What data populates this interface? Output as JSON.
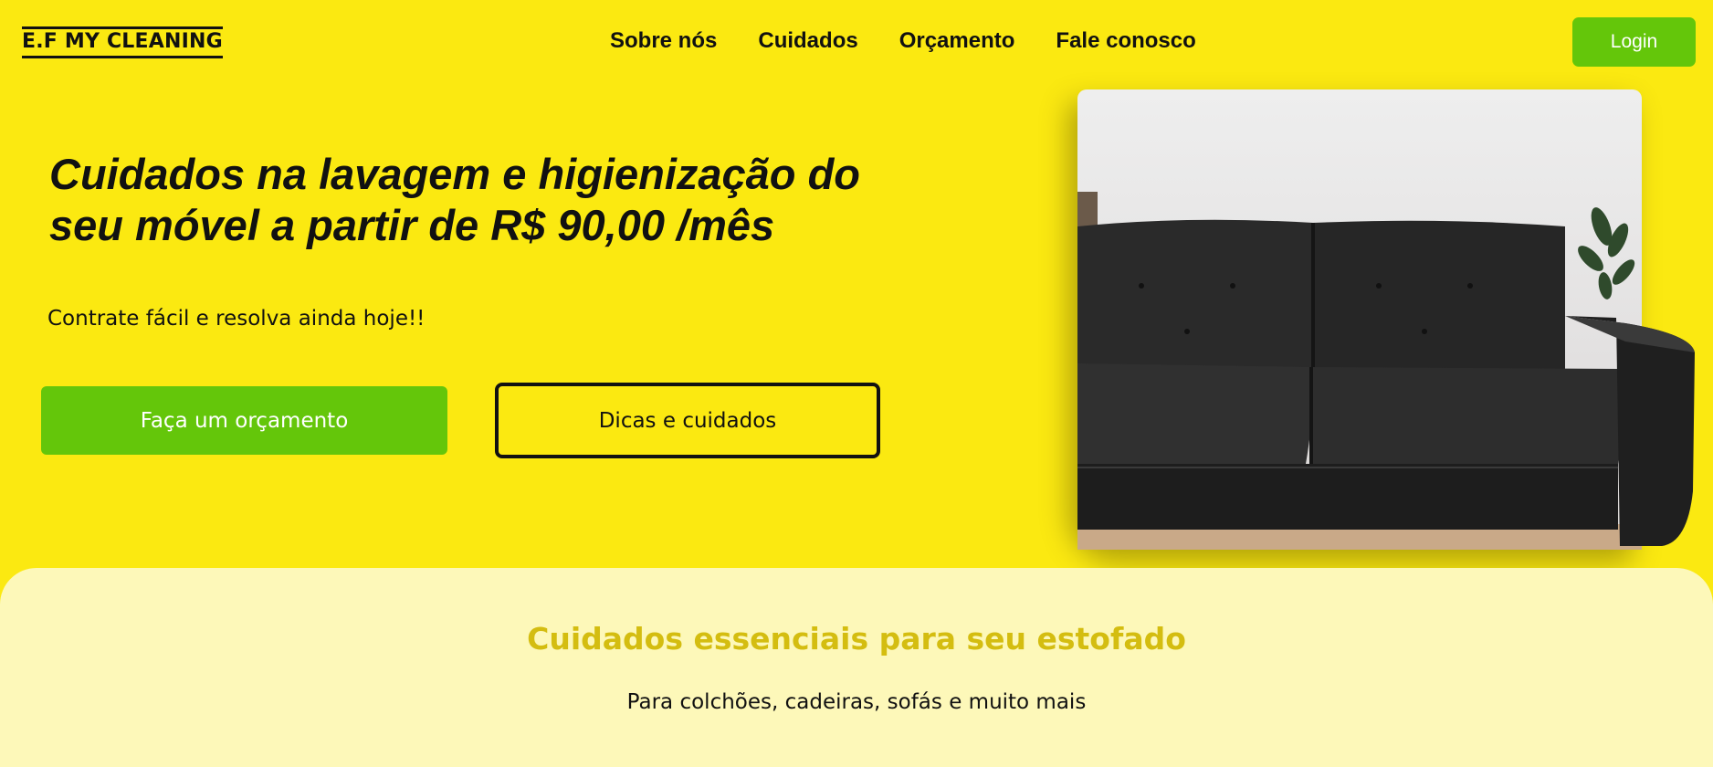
{
  "header": {
    "logo": "E.F MY CLEANING",
    "nav": [
      {
        "label": "Sobre nós"
      },
      {
        "label": "Cuidados"
      },
      {
        "label": "Orçamento"
      },
      {
        "label": "Fale conosco"
      }
    ],
    "login_label": "Login"
  },
  "hero": {
    "title_line1": "Cuidados na lavagem e higienização do",
    "title_line2": "seu móvel a partir de R$ 90,00 /mês",
    "subtitle": "Contrate fácil e resolva ainda hoje!!",
    "primary_button": "Faça um orçamento",
    "secondary_button": "Dicas e cuidados",
    "image_icon": "sofa-photo"
  },
  "section": {
    "title": "Cuidados essenciais para seu estofado",
    "subtitle": "Para colchões, cadeiras, sofás e muito mais"
  },
  "colors": {
    "background": "#fbe911",
    "accent_green": "#64c60a",
    "section_bg": "#fdf8b9",
    "section_title": "#d4bd10"
  }
}
